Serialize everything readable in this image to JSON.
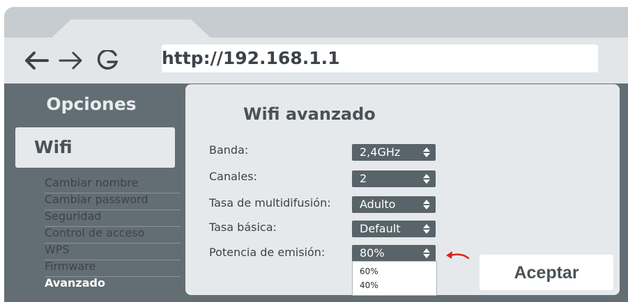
{
  "browser": {
    "url": "http://192.168.1.1"
  },
  "sidebar": {
    "title": "Opciones",
    "section": "Wifi",
    "items": [
      {
        "label": "Cambiar nombre"
      },
      {
        "label": "Cambiar password"
      },
      {
        "label": "Seguridad"
      },
      {
        "label": "Control de acceso"
      },
      {
        "label": "WPS"
      },
      {
        "label": "Firmware"
      },
      {
        "label": "Avanzado",
        "active": true
      }
    ]
  },
  "main": {
    "title": "Wifi avanzado",
    "fields": [
      {
        "label": "Banda:",
        "value": "2,4GHz"
      },
      {
        "label": "Canales:",
        "value": "2"
      },
      {
        "label": "Tasa de multidifusión:",
        "value": "Adulto"
      },
      {
        "label": "Tasa básica:",
        "value": "Default"
      },
      {
        "label": "Potencia de emisión:",
        "value": "80%"
      }
    ],
    "dropdown_options": [
      "60%",
      "40%"
    ],
    "accept_label": "Aceptar"
  },
  "colors": {
    "frame": "#c6ccd0",
    "toolbar": "#e2e6e8",
    "sidebar": "#636d74",
    "panel": "#e6e9eb",
    "select": "#58636a",
    "highlight_arrow": "#e02020"
  }
}
